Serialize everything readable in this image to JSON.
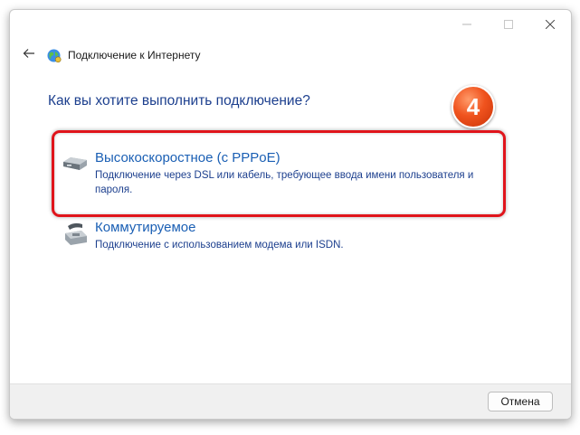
{
  "window": {
    "title": "Подключение к Интернету",
    "controls": {
      "minimize_icon": "minimize-icon",
      "maximize_icon": "maximize-icon",
      "close_icon": "close-icon"
    }
  },
  "header": {
    "back_icon": "arrow-left-icon",
    "app_icon": "network-globe-icon"
  },
  "question": "Как вы хотите выполнить подключение?",
  "step_badge": "4",
  "options": [
    {
      "icon": "broadband-modem-icon",
      "title": "Высокоскоростное (с PPPoE)",
      "description_line1": "Подключение через DSL или кабель, требующее ввода имени пользователя и",
      "description_line2": "пароля."
    },
    {
      "icon": "dialup-phone-icon",
      "title": "Коммутируемое",
      "description_line1": "Подключение с использованием модема или ISDN."
    }
  ],
  "footer": {
    "cancel_label": "Отмена"
  },
  "colors": {
    "highlight": "#e0141b",
    "link_blue": "#1a5fb4",
    "heading_blue": "#1c3f8e",
    "badge": "#f0531e"
  }
}
